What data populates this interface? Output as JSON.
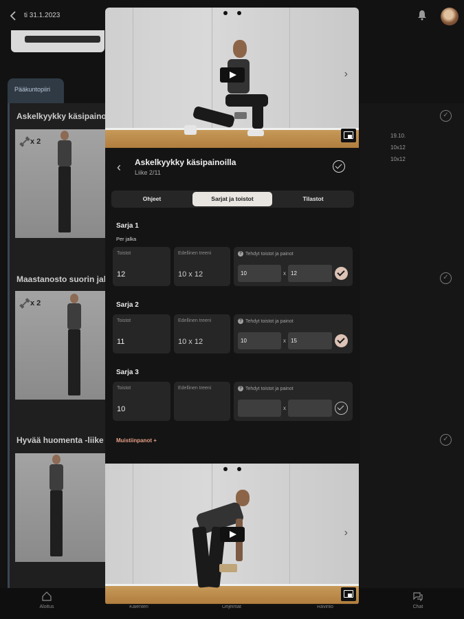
{
  "background": {
    "date": "ti 31.1.2023",
    "tab_label": "Pääkuntopiiri",
    "exercises": [
      {
        "title": "Askelkyykky käsipainoilla",
        "dumbbell_count": "x 2"
      },
      {
        "title": "Maastanosto suorin jaloin",
        "dumbbell_count": "x 2"
      },
      {
        "title": "Hyvää huomenta -liike le",
        "dumbbell_count": ""
      }
    ],
    "side_date": "19.10.",
    "side_values": [
      "10x12",
      "10x12"
    ],
    "nav": [
      "Aloitus",
      "Kalenteri",
      "Ohjelmat",
      "Ravinto",
      "Chat"
    ]
  },
  "modal": {
    "exercise_title": "Askelkyykky käsipainoilla",
    "exercise_subtitle": "Liike 2/11",
    "tabs": [
      {
        "label": "Ohjeet",
        "active": false
      },
      {
        "label": "Sarjat ja toistot",
        "active": true
      },
      {
        "label": "Tilastot",
        "active": false
      }
    ],
    "per_side": "Per jalka",
    "labels": {
      "reps": "Toistot",
      "previous": "Edellinen treeni",
      "done": "Tehdyt toistot ja painot",
      "times": "x"
    },
    "sets": [
      {
        "title": "Sarja 1",
        "reps": "12",
        "previous": "10 x 12",
        "weight": "10",
        "done_reps": "12",
        "completed": true
      },
      {
        "title": "Sarja 2",
        "reps": "11",
        "previous": "10 x 12",
        "weight": "10",
        "done_reps": "15",
        "completed": true
      },
      {
        "title": "Sarja 3",
        "reps": "10",
        "previous": "",
        "weight": "",
        "done_reps": "",
        "completed": false
      }
    ],
    "notes_label": "Muistiinpanot +"
  },
  "colors": {
    "accent": "#e6a087",
    "check_fill": "#dcc3b5",
    "active_tab": "#e9e6e2"
  }
}
